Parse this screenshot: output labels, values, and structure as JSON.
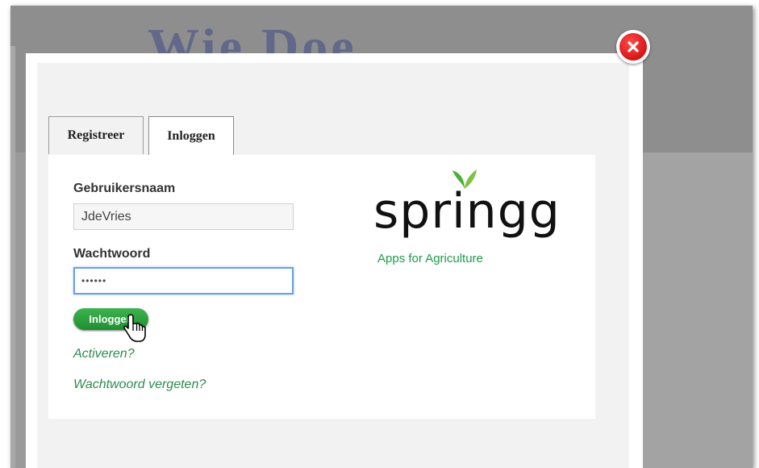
{
  "tabs": [
    {
      "label": "Registreer",
      "active": false
    },
    {
      "label": "Inloggen",
      "active": true
    }
  ],
  "form": {
    "username_label": "Gebruikersnaam",
    "username_value": "JdeVries",
    "password_label": "Wachtwoord",
    "password_value": "••••••",
    "login_button": "Inloggen",
    "activate_link": "Activeren?",
    "forgot_link": "Wachtwoord vergeten?"
  },
  "logo": {
    "wordmark": "springg",
    "tagline": "Apps for Agriculture"
  },
  "colors": {
    "accent_green": "#2e8b4e",
    "button_green": "#1e8f31",
    "close_red": "#d60000",
    "focus_blue": "#6aa0e0"
  },
  "icons": {
    "close": "close-icon",
    "cursor": "hand-pointer-icon",
    "leaves": "sprout-leaves-icon"
  }
}
